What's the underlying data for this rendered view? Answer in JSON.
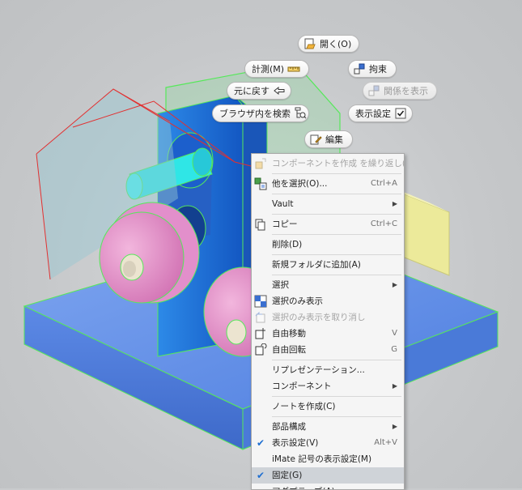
{
  "marking_menu": {
    "open": "開く(O)",
    "measure": "計測(M)",
    "constrain": "拘束",
    "undo": "元に戻す",
    "show_relationships": "関係を表示",
    "find_in_browser": "ブラウザ内を検索",
    "visibility": "表示設定",
    "edit": "編集"
  },
  "context_menu": {
    "items": [
      {
        "label": "コンポーネントを作成 を繰り返し(R)",
        "shortcut": "",
        "disabled": true
      },
      {
        "label": "他を選択(O)...",
        "shortcut": "Ctrl+A"
      },
      {
        "label": "Vault",
        "submenu": true
      },
      {
        "label": "コピー",
        "shortcut": "Ctrl+C"
      },
      {
        "label": "削除(D)",
        "shortcut": ""
      },
      {
        "label": "新規フォルダに追加(A)",
        "shortcut": ""
      },
      {
        "label": "選択",
        "submenu": true
      },
      {
        "label": "選択のみ表示",
        "shortcut": ""
      },
      {
        "label": "選択のみ表示を取り消し",
        "shortcut": "",
        "disabled": true
      },
      {
        "label": "自由移動",
        "shortcut": "V"
      },
      {
        "label": "自由回転",
        "shortcut": "G"
      },
      {
        "label": "リプレゼンテーション...",
        "shortcut": ""
      },
      {
        "label": "コンポーネント",
        "submenu": true
      },
      {
        "label": "ノートを作成(C)",
        "shortcut": ""
      },
      {
        "label": "部品構成",
        "submenu": true
      },
      {
        "label": "表示設定(V)",
        "shortcut": "Alt+V",
        "checked": true
      },
      {
        "label": "iMate 記号の表示設定(M)",
        "shortcut": ""
      },
      {
        "label": "固定(G)",
        "shortcut": "",
        "checked": true,
        "highlighted": true
      },
      {
        "label": "アダプティブ(A)",
        "shortcut": ""
      }
    ]
  },
  "colors": {
    "accent": "#1f6fd1",
    "menu_highlight": "#cfd3d8"
  }
}
